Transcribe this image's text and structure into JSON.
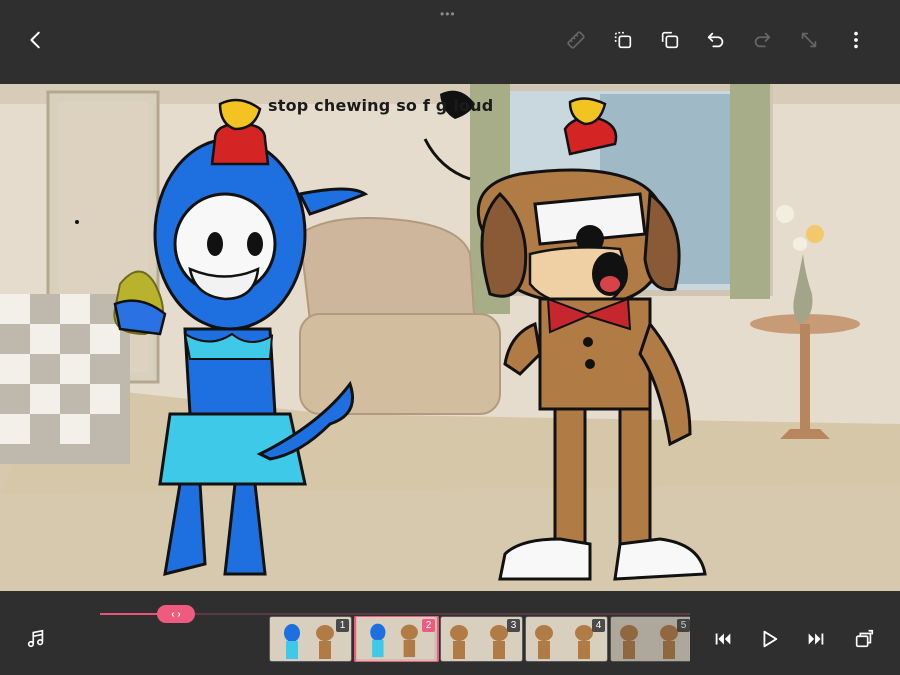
{
  "topbar": {
    "grabber": "•••",
    "back_icon": "chevron-left-icon",
    "tools": [
      "ruler-icon",
      "duplicate-frame-icon",
      "copy-icon",
      "undo-icon",
      "redo-icon",
      "expand-icon",
      "more-icon"
    ]
  },
  "canvas": {
    "caption": "stop chewing so f    g loud"
  },
  "timeline": {
    "scrubber_label": "‹ ›",
    "progress": 0.14,
    "frames": [
      {
        "number": "1",
        "selected": false
      },
      {
        "number": "2",
        "selected": true
      },
      {
        "number": "3",
        "selected": false
      },
      {
        "number": "4",
        "selected": false
      },
      {
        "number": "5",
        "selected": false
      }
    ]
  },
  "controls": {
    "left": "music-note-icon",
    "right": [
      "skip-to-start-icon",
      "play-icon",
      "skip-to-end-icon",
      "layers-icon"
    ]
  },
  "colors": {
    "accent": "#ef5b7f",
    "bar": "#2f2f30"
  }
}
